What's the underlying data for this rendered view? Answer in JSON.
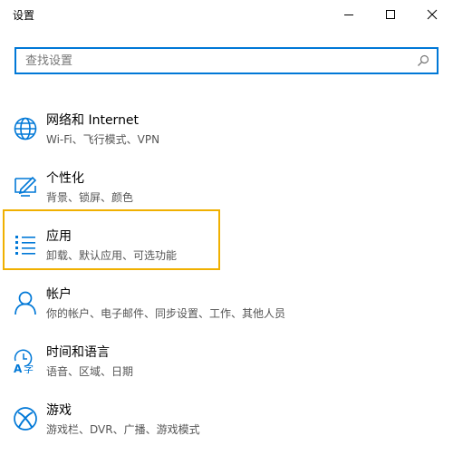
{
  "window": {
    "title": "设置",
    "controls": {
      "minimize": "minimize",
      "maximize": "maximize",
      "close": "close"
    }
  },
  "search": {
    "placeholder": "查找设置",
    "value": ""
  },
  "categories": [
    {
      "title": "网络和 Internet",
      "subtitle": "Wi-Fi、飞行模式、VPN",
      "icon": "globe-icon"
    },
    {
      "title": "个性化",
      "subtitle": "背景、锁屏、颜色",
      "icon": "personalization-icon"
    },
    {
      "title": "应用",
      "subtitle": "卸载、默认应用、可选功能",
      "icon": "apps-list-icon"
    },
    {
      "title": "帐户",
      "subtitle": "你的帐户、电子邮件、同步设置、工作、其他人员",
      "icon": "person-icon"
    },
    {
      "title": "时间和语言",
      "subtitle": "语音、区域、日期",
      "icon": "time-language-icon"
    },
    {
      "title": "游戏",
      "subtitle": "游戏栏、DVR、广播、游戏模式",
      "icon": "xbox-icon"
    }
  ],
  "colors": {
    "accent": "#0078d7",
    "highlight": "#f0b000"
  }
}
